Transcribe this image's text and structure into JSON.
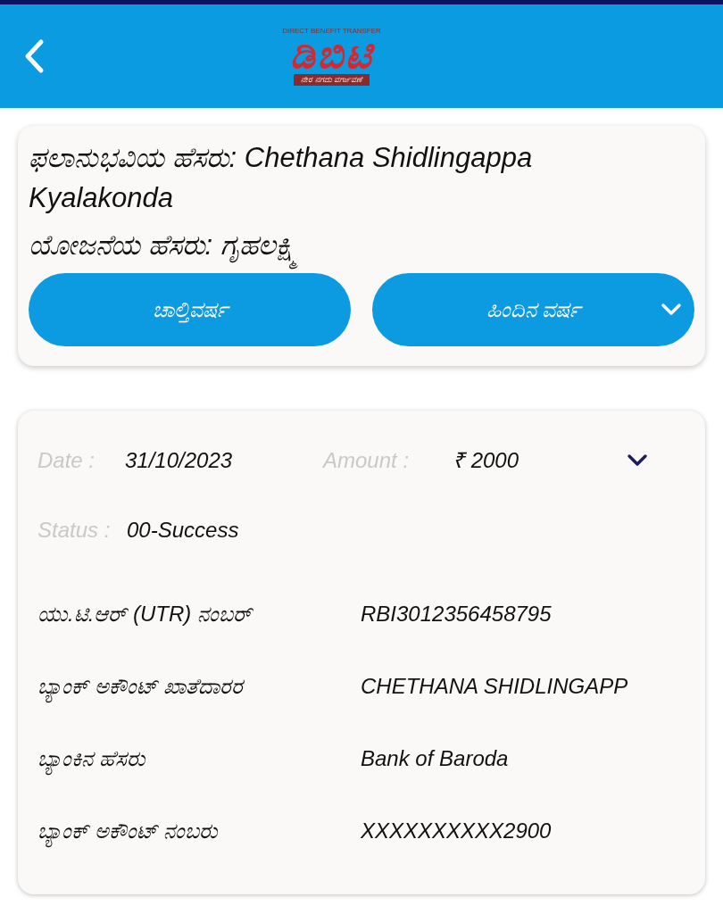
{
  "header": {
    "logo": {
      "title": "ಡಿಬಿಟಿ",
      "subtitle": "DIRECT BENEFIT TRANSFER",
      "tagline": "ನೇರ ನಗದು ವರ್ಗಾವಣೆ"
    }
  },
  "beneficiary": {
    "name_label": "ಫಲಾನುಭವಿಯ ಹೆಸರು:",
    "name": "Chethana Shidlingappa Kyalakonda",
    "scheme_label": "ಯೋಜನೆಯ ಹೆಸರು:",
    "scheme": "ಗೃಹಲಕ್ಷ್ಮಿ"
  },
  "year_buttons": [
    {
      "label": "ಚಾಲ್ತಿವರ್ಷ",
      "dropdown": false
    },
    {
      "label": "ಹಿಂದಿನ ವರ್ಷ",
      "dropdown": true
    }
  ],
  "payment": {
    "date_label": "Date :",
    "date": "31/10/2023",
    "amount_label": "Amount :",
    "amount": "₹ 2000",
    "status_label": "Status :",
    "status": "00-Success",
    "details": [
      {
        "label": "ಯು.ಟಿ.ಆರ್ (UTR) ನಂಬರ್",
        "value": "RBI3012356458795"
      },
      {
        "label": "ಬ್ಯಾಂಕ್ ಅಕೌಂಟ್ ಖಾತೆದಾರರ",
        "value": "CHETHANA SHIDLINGAPP"
      },
      {
        "label": "ಬ್ಯಾಂಕಿನ ಹೆಸರು",
        "value": "Bank of Baroda"
      },
      {
        "label": "ಬ್ಯಾಂಕ್ ಅಕೌಂಟ್ ನಂಬರು",
        "value": "XXXXXXXXXX2900"
      }
    ]
  }
}
